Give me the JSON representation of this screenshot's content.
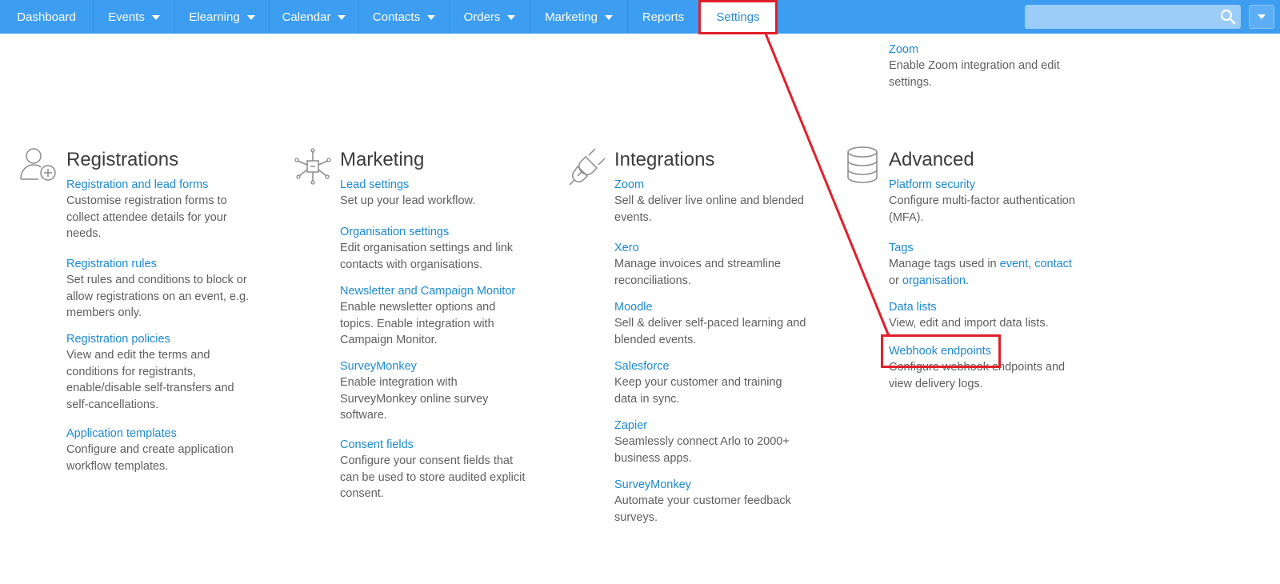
{
  "nav": {
    "items": [
      {
        "label": "Dashboard",
        "dropdown": false
      },
      {
        "label": "Events",
        "dropdown": true
      },
      {
        "label": "Elearning",
        "dropdown": true
      },
      {
        "label": "Calendar",
        "dropdown": true
      },
      {
        "label": "Contacts",
        "dropdown": true
      },
      {
        "label": "Orders",
        "dropdown": true
      },
      {
        "label": "Marketing",
        "dropdown": true
      },
      {
        "label": "Reports",
        "dropdown": false
      },
      {
        "label": "Settings",
        "dropdown": false,
        "active": true
      }
    ],
    "search_placeholder": ""
  },
  "top_zoom": {
    "title": "Zoom",
    "desc": "Enable Zoom integration and edit settings."
  },
  "sections": {
    "registrations": {
      "title": "Registrations",
      "icon": "user-add-icon",
      "entries": [
        {
          "title": "Registration and lead forms",
          "desc": "Customise registration forms to collect attendee details for your needs."
        },
        {
          "title": "Registration rules",
          "desc": "Set rules and conditions to block or allow registrations on an event, e.g. members only."
        },
        {
          "title": "Registration policies",
          "desc": "View and edit the terms and conditions for registrants, enable/disable self-transfers and self-cancellations."
        },
        {
          "title": "Application templates",
          "desc": "Configure and create application workflow templates."
        }
      ]
    },
    "marketing": {
      "title": "Marketing",
      "icon": "network-hub-icon",
      "entries": [
        {
          "title": "Lead settings",
          "desc": "Set up your lead workflow."
        },
        {
          "title": "Organisation settings",
          "desc": "Edit organisation settings and link contacts with organisations."
        },
        {
          "title": "Newsletter and Campaign Monitor",
          "desc": "Enable newsletter options and topics. Enable integration with Campaign Monitor."
        },
        {
          "title": "SurveyMonkey",
          "desc": "Enable integration with SurveyMonkey online survey software."
        },
        {
          "title": "Consent fields",
          "desc": "Configure your consent fields that can be used to store audited explicit consent."
        }
      ]
    },
    "integrations": {
      "title": "Integrations",
      "icon": "plug-icon",
      "entries": [
        {
          "title": "Zoom",
          "desc": "Sell & deliver live online and blended events."
        },
        {
          "title": "Xero",
          "desc": "Manage invoices and streamline reconciliations."
        },
        {
          "title": "Moodle",
          "desc": "Sell & deliver self-paced learning and blended events."
        },
        {
          "title": "Salesforce",
          "desc": "Keep your customer and training data in sync."
        },
        {
          "title": "Zapier",
          "desc": "Seamlessly connect Arlo to 2000+ business apps."
        },
        {
          "title": "SurveyMonkey",
          "desc": "Automate your customer feedback surveys."
        }
      ]
    },
    "advanced": {
      "title": "Advanced",
      "icon": "database-icon",
      "entries": [
        {
          "title": "Platform security",
          "desc": "Configure multi-factor authentication (MFA)."
        },
        {
          "title": "Tags",
          "desc_prefix": "Manage tags used in ",
          "link_event": "event",
          "sep": ", ",
          "link_contact": "contact",
          "desc_or": "or ",
          "link_organisation": "organisation",
          "desc_end": "."
        },
        {
          "title": "Data lists",
          "desc": "View, edit and import data lists."
        },
        {
          "title": "Webhook endpoints",
          "desc": "Configure webhook endpoints and view delivery logs."
        }
      ]
    }
  },
  "colors": {
    "nav_bg": "#3d9df0",
    "link": "#1d8ad1",
    "annotation": "#e0202a"
  }
}
